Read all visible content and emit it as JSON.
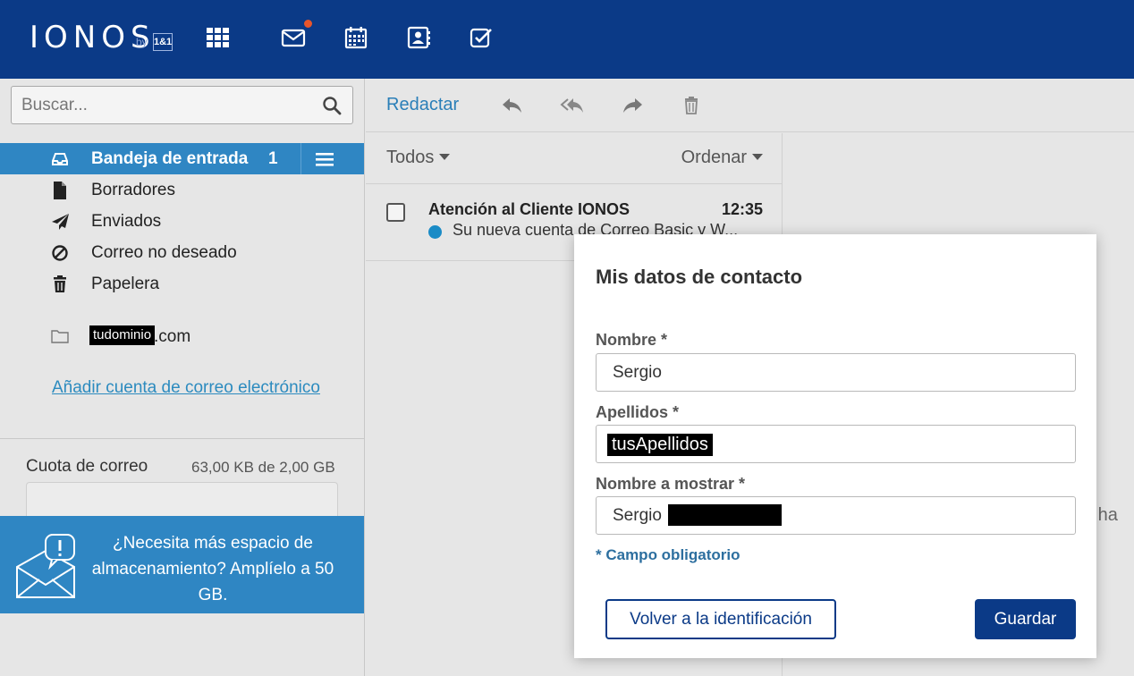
{
  "header": {
    "brand": "IONOS",
    "brand_by": "by",
    "brand_partner": "1&1",
    "notification_color": "#e8552b",
    "icons": [
      "apps-grid-icon",
      "mail-icon",
      "calendar-icon",
      "contacts-icon",
      "tasks-icon"
    ]
  },
  "search": {
    "placeholder": "Buscar..."
  },
  "folders": {
    "inbox": {
      "label": "Bandeja de entrada",
      "count": "1",
      "icon": "inbox-icon"
    },
    "drafts": {
      "label": "Borradores",
      "icon": "draft-icon"
    },
    "sent": {
      "label": "Enviados",
      "icon": "paper-plane-icon"
    },
    "spam": {
      "label": "Correo no deseado",
      "icon": "spam-icon"
    },
    "trash": {
      "label": "Papelera",
      "icon": "trash-icon"
    },
    "domain_redacted": "tudominio",
    "domain_suffix": ".com"
  },
  "add_account": "Añadir cuenta de correo electrónico",
  "quota": {
    "label": "Cuota de correo",
    "value": "63,00 KB de 2,00 GB"
  },
  "promo": {
    "text": "¿Necesita más espacio de almacenamiento? Amplíelo a 50 GB."
  },
  "toolbar": {
    "compose": "Redactar"
  },
  "list": {
    "filter": "Todos",
    "sort": "Ordenar",
    "items": [
      {
        "sender": "Atención al Cliente IONOS",
        "time": "12:35",
        "subject": "Su nueva cuenta de Correo Basic y W..."
      }
    ]
  },
  "reading_pane": {
    "partial_text": "o ha"
  },
  "modal": {
    "title": "Mis datos de contacto",
    "nombre_label": "Nombre *",
    "nombre_value": "Sergio",
    "apellidos_label": "Apellidos *",
    "apellidos_value": "tusApellidos",
    "display_label": "Nombre a mostrar *",
    "display_value": "Sergio",
    "required_note": "* Campo obligatorio",
    "back_button": "Volver a la identificación",
    "save_button": "Guardar"
  },
  "colors": {
    "header_bg": "#0b3a87",
    "active_folder_bg": "#2f86c3",
    "link": "#2c8bbf",
    "primary_button": "#0b3a87"
  }
}
